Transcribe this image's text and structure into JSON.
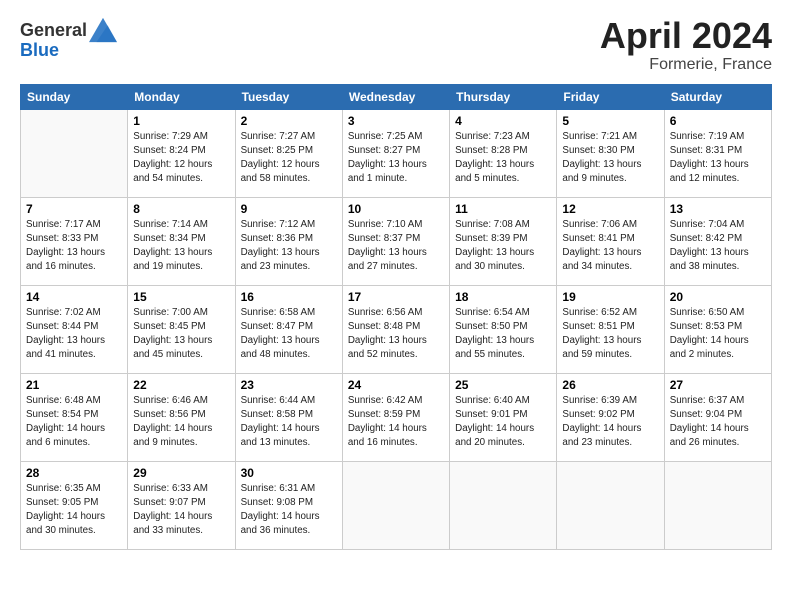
{
  "header": {
    "logo_line1": "General",
    "logo_line2": "Blue",
    "title": "April 2024",
    "location": "Formerie, France"
  },
  "weekdays": [
    "Sunday",
    "Monday",
    "Tuesday",
    "Wednesday",
    "Thursday",
    "Friday",
    "Saturday"
  ],
  "weeks": [
    [
      {
        "day": "",
        "info": ""
      },
      {
        "day": "1",
        "info": "Sunrise: 7:29 AM\nSunset: 8:24 PM\nDaylight: 12 hours\nand 54 minutes."
      },
      {
        "day": "2",
        "info": "Sunrise: 7:27 AM\nSunset: 8:25 PM\nDaylight: 12 hours\nand 58 minutes."
      },
      {
        "day": "3",
        "info": "Sunrise: 7:25 AM\nSunset: 8:27 PM\nDaylight: 13 hours\nand 1 minute."
      },
      {
        "day": "4",
        "info": "Sunrise: 7:23 AM\nSunset: 8:28 PM\nDaylight: 13 hours\nand 5 minutes."
      },
      {
        "day": "5",
        "info": "Sunrise: 7:21 AM\nSunset: 8:30 PM\nDaylight: 13 hours\nand 9 minutes."
      },
      {
        "day": "6",
        "info": "Sunrise: 7:19 AM\nSunset: 8:31 PM\nDaylight: 13 hours\nand 12 minutes."
      }
    ],
    [
      {
        "day": "7",
        "info": "Sunrise: 7:17 AM\nSunset: 8:33 PM\nDaylight: 13 hours\nand 16 minutes."
      },
      {
        "day": "8",
        "info": "Sunrise: 7:14 AM\nSunset: 8:34 PM\nDaylight: 13 hours\nand 19 minutes."
      },
      {
        "day": "9",
        "info": "Sunrise: 7:12 AM\nSunset: 8:36 PM\nDaylight: 13 hours\nand 23 minutes."
      },
      {
        "day": "10",
        "info": "Sunrise: 7:10 AM\nSunset: 8:37 PM\nDaylight: 13 hours\nand 27 minutes."
      },
      {
        "day": "11",
        "info": "Sunrise: 7:08 AM\nSunset: 8:39 PM\nDaylight: 13 hours\nand 30 minutes."
      },
      {
        "day": "12",
        "info": "Sunrise: 7:06 AM\nSunset: 8:41 PM\nDaylight: 13 hours\nand 34 minutes."
      },
      {
        "day": "13",
        "info": "Sunrise: 7:04 AM\nSunset: 8:42 PM\nDaylight: 13 hours\nand 38 minutes."
      }
    ],
    [
      {
        "day": "14",
        "info": "Sunrise: 7:02 AM\nSunset: 8:44 PM\nDaylight: 13 hours\nand 41 minutes."
      },
      {
        "day": "15",
        "info": "Sunrise: 7:00 AM\nSunset: 8:45 PM\nDaylight: 13 hours\nand 45 minutes."
      },
      {
        "day": "16",
        "info": "Sunrise: 6:58 AM\nSunset: 8:47 PM\nDaylight: 13 hours\nand 48 minutes."
      },
      {
        "day": "17",
        "info": "Sunrise: 6:56 AM\nSunset: 8:48 PM\nDaylight: 13 hours\nand 52 minutes."
      },
      {
        "day": "18",
        "info": "Sunrise: 6:54 AM\nSunset: 8:50 PM\nDaylight: 13 hours\nand 55 minutes."
      },
      {
        "day": "19",
        "info": "Sunrise: 6:52 AM\nSunset: 8:51 PM\nDaylight: 13 hours\nand 59 minutes."
      },
      {
        "day": "20",
        "info": "Sunrise: 6:50 AM\nSunset: 8:53 PM\nDaylight: 14 hours\nand 2 minutes."
      }
    ],
    [
      {
        "day": "21",
        "info": "Sunrise: 6:48 AM\nSunset: 8:54 PM\nDaylight: 14 hours\nand 6 minutes."
      },
      {
        "day": "22",
        "info": "Sunrise: 6:46 AM\nSunset: 8:56 PM\nDaylight: 14 hours\nand 9 minutes."
      },
      {
        "day": "23",
        "info": "Sunrise: 6:44 AM\nSunset: 8:58 PM\nDaylight: 14 hours\nand 13 minutes."
      },
      {
        "day": "24",
        "info": "Sunrise: 6:42 AM\nSunset: 8:59 PM\nDaylight: 14 hours\nand 16 minutes."
      },
      {
        "day": "25",
        "info": "Sunrise: 6:40 AM\nSunset: 9:01 PM\nDaylight: 14 hours\nand 20 minutes."
      },
      {
        "day": "26",
        "info": "Sunrise: 6:39 AM\nSunset: 9:02 PM\nDaylight: 14 hours\nand 23 minutes."
      },
      {
        "day": "27",
        "info": "Sunrise: 6:37 AM\nSunset: 9:04 PM\nDaylight: 14 hours\nand 26 minutes."
      }
    ],
    [
      {
        "day": "28",
        "info": "Sunrise: 6:35 AM\nSunset: 9:05 PM\nDaylight: 14 hours\nand 30 minutes."
      },
      {
        "day": "29",
        "info": "Sunrise: 6:33 AM\nSunset: 9:07 PM\nDaylight: 14 hours\nand 33 minutes."
      },
      {
        "day": "30",
        "info": "Sunrise: 6:31 AM\nSunset: 9:08 PM\nDaylight: 14 hours\nand 36 minutes."
      },
      {
        "day": "",
        "info": ""
      },
      {
        "day": "",
        "info": ""
      },
      {
        "day": "",
        "info": ""
      },
      {
        "day": "",
        "info": ""
      }
    ]
  ]
}
